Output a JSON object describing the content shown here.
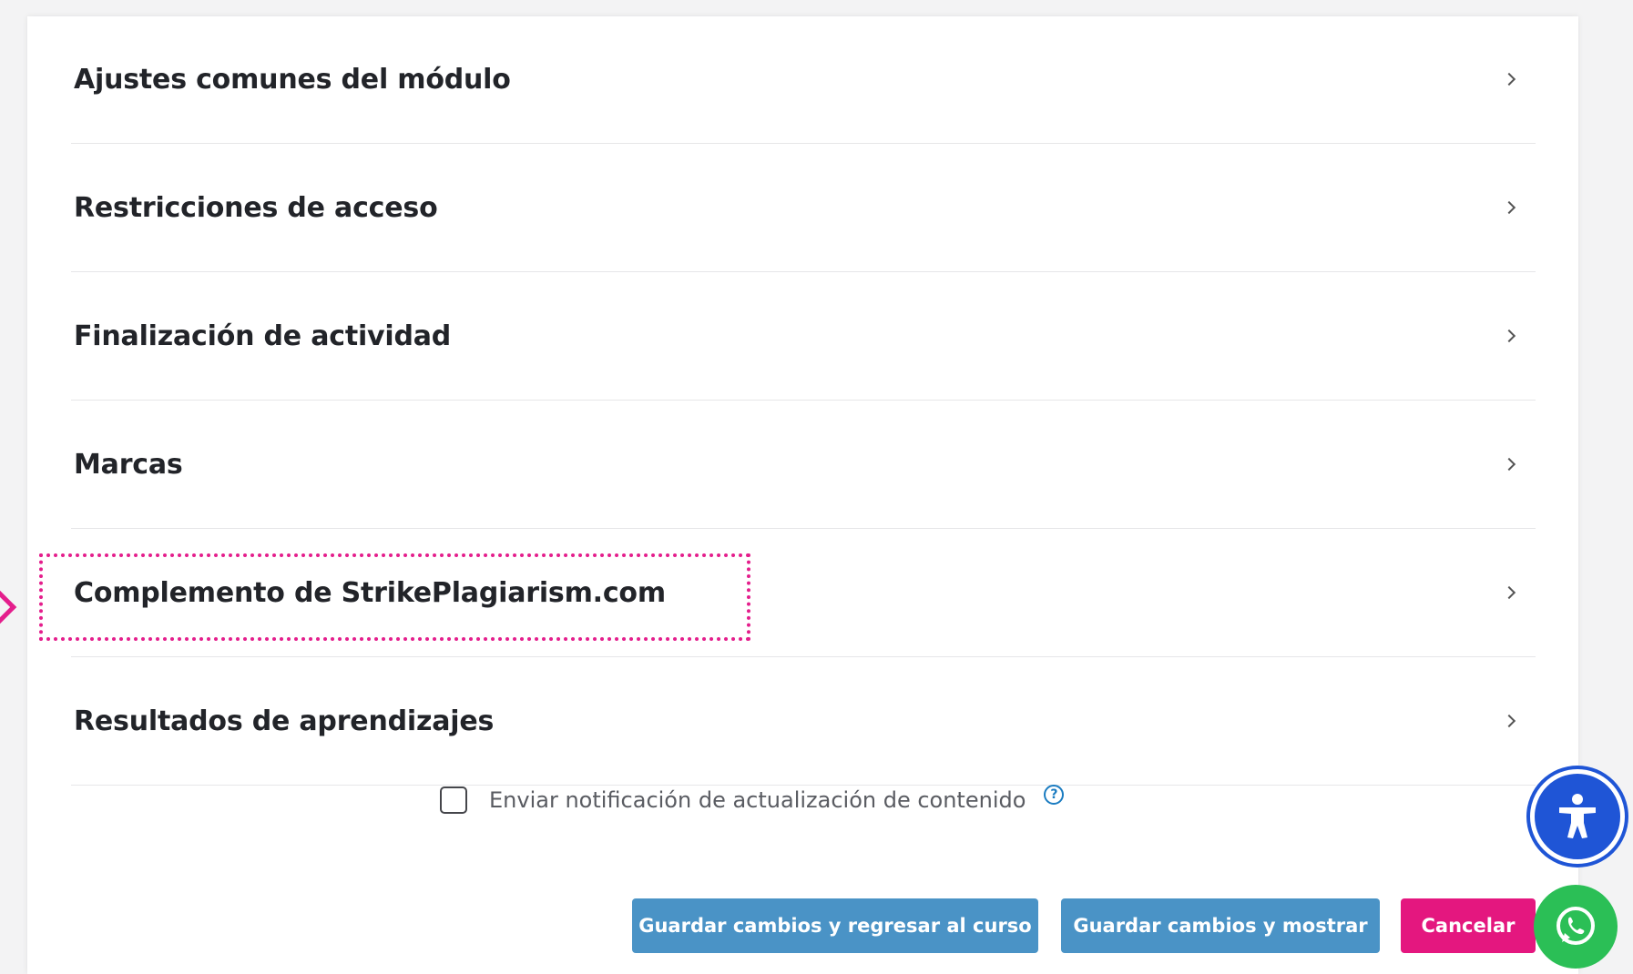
{
  "sections": [
    {
      "label": "Ajustes comunes del módulo"
    },
    {
      "label": "Restricciones de acceso"
    },
    {
      "label": "Finalización de actividad"
    },
    {
      "label": "Marcas"
    },
    {
      "label": "Complemento de StrikePlagiarism.com"
    },
    {
      "label": "Resultados de aprendizajes"
    }
  ],
  "notify": {
    "label": "Enviar notificación de actualización de contenido",
    "checked": false,
    "help_icon": "question-circle-icon"
  },
  "buttons": {
    "save_return": "Guardar cambios y regresar al curso",
    "save_display": "Guardar cambios y mostrar",
    "cancel": "Cancelar"
  },
  "floating": {
    "accessibility_icon": "accessibility-person-icon",
    "whatsapp_icon": "whatsapp-icon"
  },
  "colors": {
    "accent_blue": "#4a93c6",
    "cancel_pink": "#e4177f",
    "highlight": "#e41e8c",
    "accessibility_blue": "#1f55d6",
    "whatsapp_green": "#2bbf56"
  }
}
